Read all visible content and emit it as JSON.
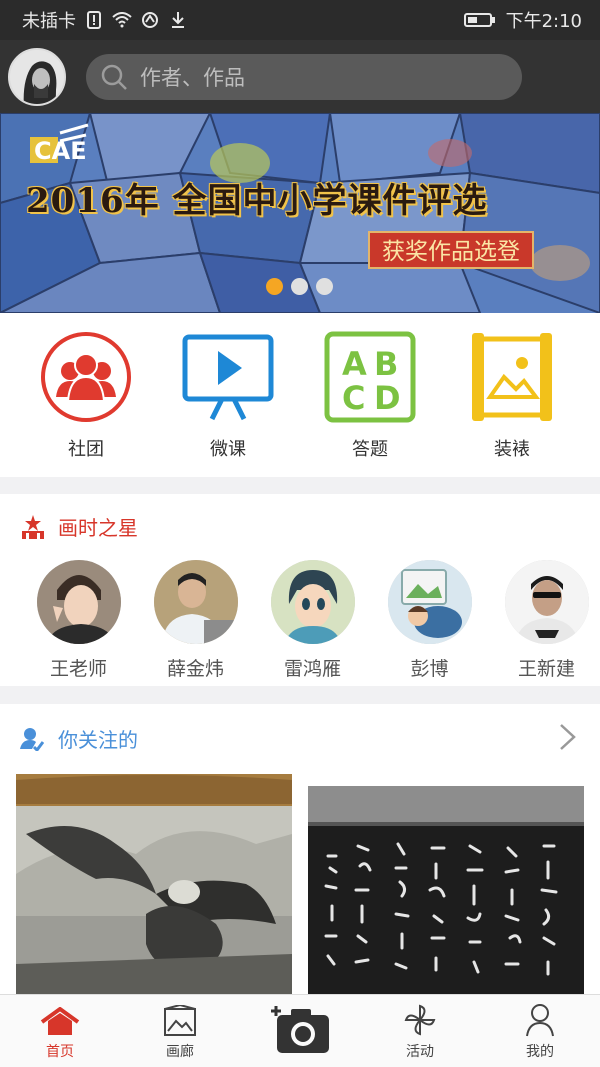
{
  "status_bar": {
    "carrier": "未插卡",
    "time": "下午2:10",
    "icons": [
      "sim-alert-icon",
      "wifi-icon",
      "vpn-icon",
      "download-icon",
      "battery-icon"
    ]
  },
  "header": {
    "search_placeholder": "作者、作品"
  },
  "banner": {
    "logo": "CAE",
    "title": "2016年 全国中小学课件评选",
    "subtitle": "获奖作品选登",
    "dots": {
      "count": 3,
      "active": 1
    }
  },
  "categories": [
    {
      "label": "社团",
      "icon": "group-icon",
      "color": "#e03a2f"
    },
    {
      "label": "微课",
      "icon": "video-play-icon",
      "color": "#1e88d6"
    },
    {
      "label": "答题",
      "icon": "abcd-icon",
      "color": "#7cc242"
    },
    {
      "label": "装裱",
      "icon": "frame-icon",
      "color": "#f2c11a"
    }
  ],
  "stars_section": {
    "title": "画时之星",
    "icon": "star-crown-icon",
    "people": [
      {
        "name": "王老师"
      },
      {
        "name": "薛金炜"
      },
      {
        "name": "雷鸿雁"
      },
      {
        "name": "彭博"
      },
      {
        "name": "王新建"
      }
    ]
  },
  "following_section": {
    "title": "你关注的",
    "icon": "user-follow-icon"
  },
  "tabbar": {
    "tabs": [
      {
        "label": "首页",
        "icon": "home-icon",
        "active": true
      },
      {
        "label": "画廊",
        "icon": "gallery-icon",
        "active": false
      },
      {
        "label": "",
        "icon": "camera-add-icon",
        "active": false
      },
      {
        "label": "活动",
        "icon": "pinwheel-icon",
        "active": false
      },
      {
        "label": "我的",
        "icon": "profile-icon",
        "active": false
      }
    ]
  },
  "colors": {
    "accent_red": "#d7362a",
    "accent_blue": "#4a90d9",
    "dot_active": "#f5a623"
  }
}
